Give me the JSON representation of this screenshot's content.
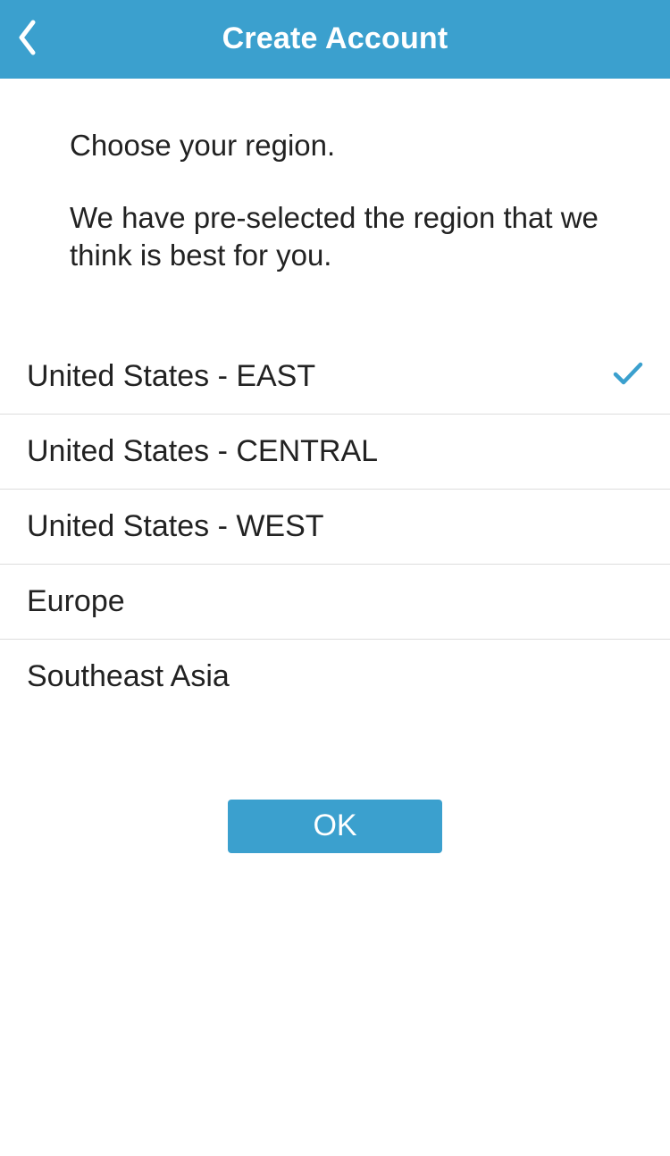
{
  "header": {
    "title": "Create Account"
  },
  "intro": {
    "line1": "Choose your region.",
    "line2": "We have pre-selected the region that we think is best for you."
  },
  "regions": [
    {
      "label": "United States - EAST",
      "selected": true
    },
    {
      "label": "United States - CENTRAL",
      "selected": false
    },
    {
      "label": "United States - WEST",
      "selected": false
    },
    {
      "label": "Europe",
      "selected": false
    },
    {
      "label": "Southeast Asia",
      "selected": false
    }
  ],
  "ok_label": "OK",
  "colors": {
    "accent": "#3ba0ce"
  }
}
